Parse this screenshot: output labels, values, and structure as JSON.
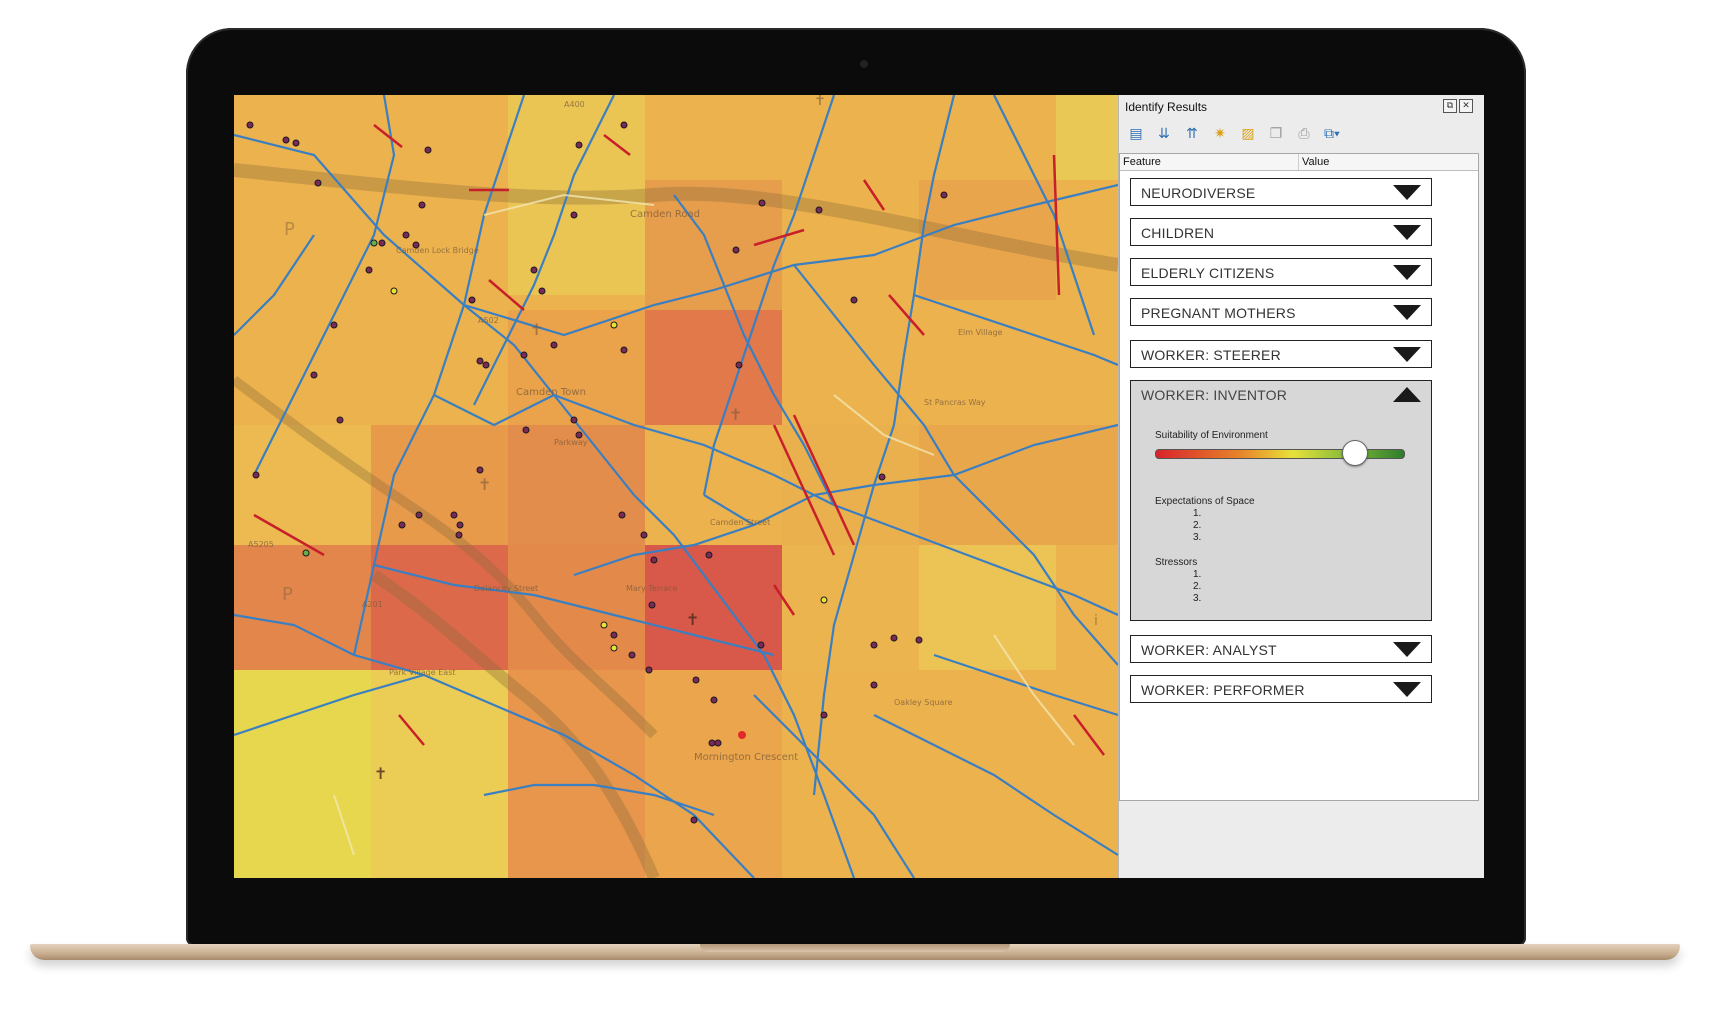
{
  "panel": {
    "title": "Identify Results",
    "window_buttons": [
      "⧉",
      "✕"
    ],
    "columns": {
      "feature": "Feature",
      "value": "Value"
    }
  },
  "toolbar_icons": [
    "expand-tree-icon",
    "expand-all-icon",
    "collapse-all-icon",
    "expand-new-icon",
    "clear-results-icon",
    "copy-icon",
    "print-icon",
    "identify-mode-icon"
  ],
  "features": [
    {
      "label": "NEURODIVERSE",
      "expanded": false
    },
    {
      "label": "CHILDREN",
      "expanded": false
    },
    {
      "label": "ELDERLY CITIZENS",
      "expanded": false
    },
    {
      "label": "PREGNANT MOTHERS",
      "expanded": false
    },
    {
      "label": "WORKER: STEERER",
      "expanded": false
    },
    {
      "label": "WORKER: INVENTOR",
      "expanded": true
    },
    {
      "label": "WORKER: ANALYST",
      "expanded": false
    },
    {
      "label": "WORKER: PERFORMER",
      "expanded": false
    }
  ],
  "inventor": {
    "slider_label": "Suitability of Environment",
    "slider_value": 0.8,
    "expectations_label": "Expectations of Space",
    "expectations_items": [
      "1.",
      "2.",
      "3."
    ],
    "stressors_label": "Stressors",
    "stressors_items": [
      "1.",
      "2.",
      "3."
    ]
  },
  "map_labels": {
    "camden_road": "Camden Road",
    "camden_town": "Camden Town",
    "mornington_crescent": "Mornington Crescent",
    "camden_lock": "Camden Lock Bridge",
    "a502": "A502",
    "a5205": "A5205",
    "a400": "A400",
    "a201": "A201",
    "delancey": "Delancey Street",
    "parkway": "Parkway",
    "mary_terrace": "Mary Terrace",
    "park_village": "Park Village East",
    "elm_village": "Elm Village",
    "st_pancras": "St Pancras Way",
    "oakley_square": "Oakley Square",
    "camden_street": "Camden Street"
  },
  "colors": {
    "heat_low": "#e8d84a",
    "heat_mid": "#eaa948",
    "heat_high": "#dc6a4a",
    "heat_max": "#d5504a",
    "roads": "#3a7fc2",
    "red_segment": "#c8202a"
  }
}
